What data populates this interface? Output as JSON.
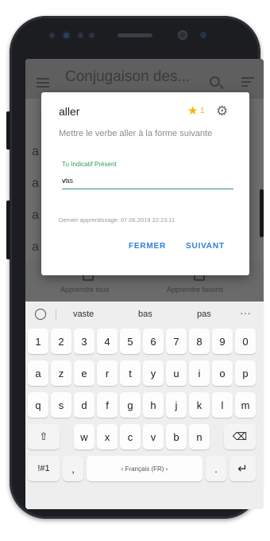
{
  "app": {
    "title": "Conjugaison des...",
    "bottom_nav": [
      "Apprendre tous",
      "Apprendre favoris"
    ]
  },
  "background_list": [
    "a",
    "a",
    "a",
    "a"
  ],
  "dialog": {
    "verb": "aller",
    "favorite_count": "1",
    "instruction": "Mettre le verbe aller à la forme suivante",
    "tense": "Tu  Indicatif Présent",
    "answer": "vas",
    "last_learning": "Dernier apprentissage: 07.06.2019 22:23:11",
    "close_label": "FERMER",
    "next_label": "SUIVANT"
  },
  "keyboard": {
    "suggestions": [
      "vaste",
      "bas",
      "pas"
    ],
    "more": "···",
    "rows": [
      [
        "1",
        "2",
        "3",
        "4",
        "5",
        "6",
        "7",
        "8",
        "9",
        "0"
      ],
      [
        "a",
        "z",
        "e",
        "r",
        "t",
        "y",
        "u",
        "i",
        "o",
        "p"
      ],
      [
        "q",
        "s",
        "d",
        "f",
        "g",
        "h",
        "j",
        "k",
        "l",
        "m"
      ],
      [
        "w",
        "x",
        "c",
        "v",
        "b",
        "n"
      ]
    ],
    "shift": "⇧",
    "backspace": "⌫",
    "symbols": "!#1",
    "comma": ",",
    "space": "‹  Français (FR)  ›",
    "period": ".",
    "enter": "↵"
  },
  "colors": {
    "accent_green": "#2e9e63",
    "accent_blue": "#2f7fd3",
    "star": "#f5b300"
  }
}
